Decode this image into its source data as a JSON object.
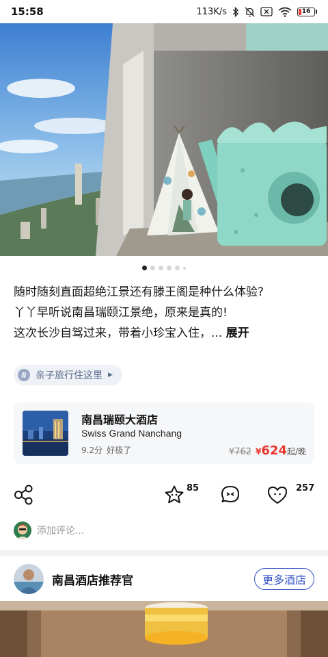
{
  "status_bar": {
    "time": "15:58",
    "network_speed": "113K/s",
    "battery_level": "16",
    "battery_fraction": 0.16,
    "icons": [
      "bluetooth-icon",
      "mute-icon",
      "no-sim-icon",
      "wifi-icon",
      "battery-icon"
    ]
  },
  "carousel": {
    "page_count": 6,
    "active_index": 0
  },
  "post": {
    "lines": [
      "随时随刻直面超绝江景还有滕王阁是种什么体验?",
      "丫丫早听说南昌瑞颐江景绝，原来是真的!",
      "这次长沙自驾过来，带着小珍宝入住，..."
    ],
    "expand_label": "展开"
  },
  "topic": {
    "hash": "#",
    "label": "亲子旅行住这里"
  },
  "hotel": {
    "name_zh": "南昌瑞颐大酒店",
    "name_en": "Swiss Grand Nanchang",
    "score": "9.2分",
    "score_text": "好极了",
    "old_price": "¥762",
    "currency": "¥",
    "price": "624",
    "price_suffix": "起/晚"
  },
  "actions": {
    "star_count": "85",
    "like_count": "257"
  },
  "comment": {
    "placeholder": "添加评论..."
  },
  "recommender": {
    "name": "南昌酒店推荐官",
    "more_label": "更多酒店"
  },
  "colors": {
    "accent_blue": "#2f4ec4",
    "price_red": "#e8352c",
    "battery_red": "#e53935"
  }
}
